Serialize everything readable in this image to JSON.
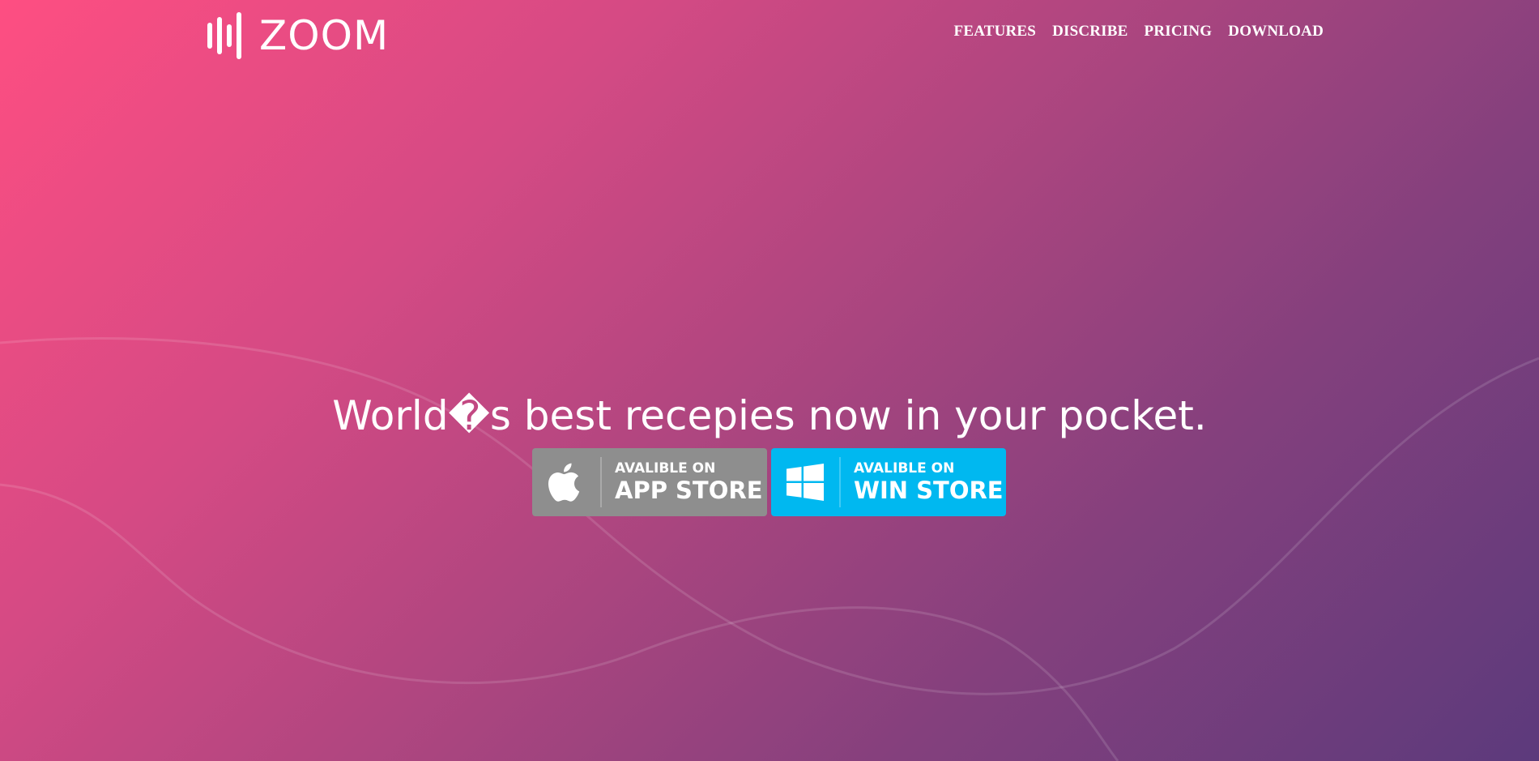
{
  "brand": {
    "name": "ZOOM",
    "logo_icon": "sound-bars-icon"
  },
  "nav": {
    "items": [
      {
        "label": "FEATURES"
      },
      {
        "label": "DISCRIBE"
      },
      {
        "label": "PRICING"
      },
      {
        "label": "DOWNLOAD"
      }
    ]
  },
  "hero": {
    "headline": "World�s best recepies now in your pocket.",
    "background_gradient": [
      "#fe4e82",
      "#5c3a7c"
    ]
  },
  "stores": {
    "apple": {
      "small": "AVALIBLE ON",
      "big": "APP STORE",
      "icon": "apple-icon",
      "color": "#8e8e8e"
    },
    "windows": {
      "small": "AVALIBLE ON",
      "big": "WIN STORE",
      "icon": "windows-icon",
      "color": "#00b8f0"
    }
  }
}
